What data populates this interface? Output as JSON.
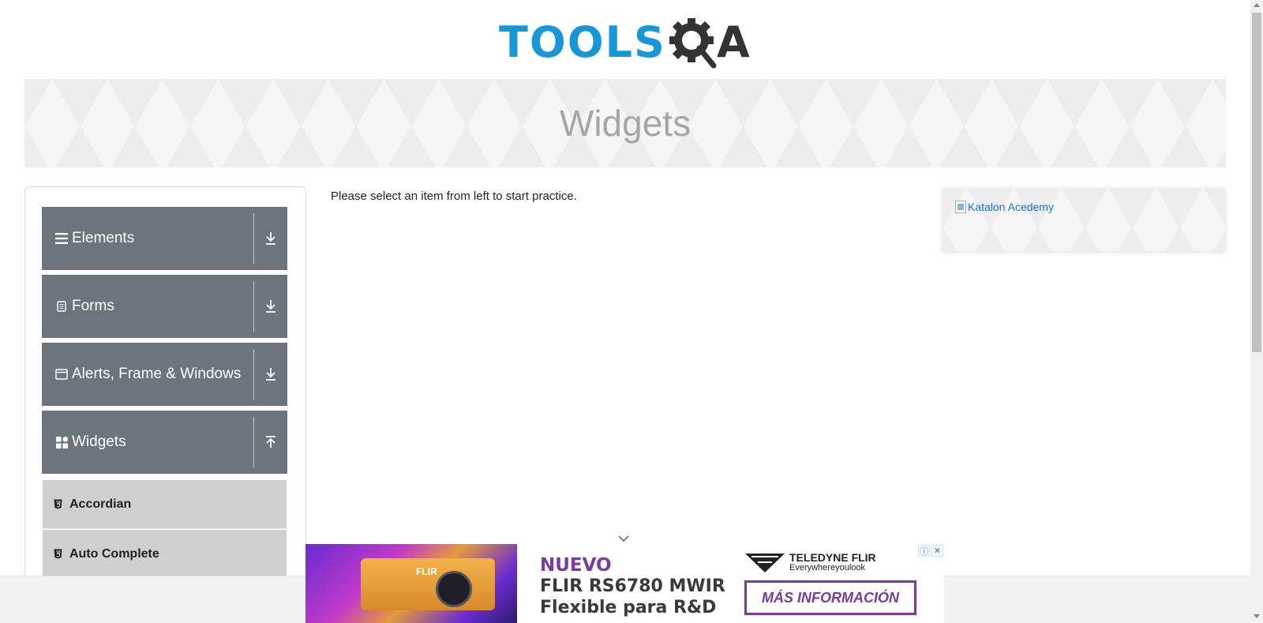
{
  "header": {
    "logo_text_primary": "TOOLS",
    "logo_text_secondary": "A",
    "logo_alt": "TOOLSQA"
  },
  "banner": {
    "title": "Widgets"
  },
  "sidebar": {
    "groups": [
      {
        "label": "Elements",
        "icon": "hamburger-icon",
        "arrow": "download-arrow-icon"
      },
      {
        "label": "Forms",
        "icon": "document-icon",
        "arrow": "download-arrow-icon"
      },
      {
        "label": "Alerts, Frame & Windows",
        "icon": "window-icon",
        "arrow": "download-arrow-icon"
      },
      {
        "label": "Widgets",
        "icon": "widgets-grid-icon",
        "arrow": "upload-arrow-icon"
      }
    ],
    "widget_items": [
      {
        "label": "Accordian",
        "icon": "html5-icon"
      },
      {
        "label": "Auto Complete",
        "icon": "html5-icon"
      }
    ]
  },
  "main": {
    "message": "Please select an item from left to start practice."
  },
  "right_ad": {
    "link_text": "Katalon Acedemy"
  },
  "bottom_ad": {
    "headline": "NUEVO",
    "line1": "FLIR RS6780 MWIR",
    "line2": "Flexible para R&D",
    "brand_name": "TELEDYNE FLIR",
    "brand_tagline": "Everywhereyoulook",
    "cta": "MÁS INFORMACIÓN",
    "camera_brand": "FLIR"
  },
  "colors": {
    "brand_blue": "#1797d7",
    "sidebar_header": "#6c757d",
    "sub_item_bg": "#d0d0d0",
    "ad_purple": "#7b3aa0"
  }
}
